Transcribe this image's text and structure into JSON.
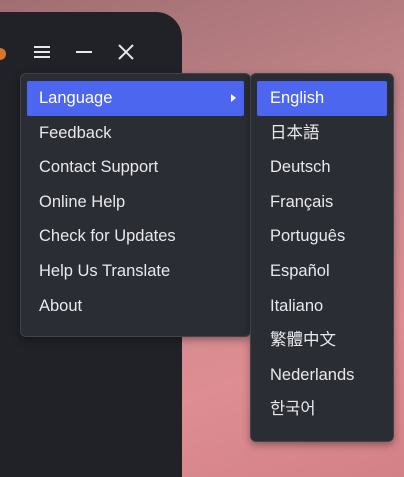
{
  "window": {
    "controls": [
      {
        "name": "menu-icon"
      },
      {
        "name": "minimize-icon"
      },
      {
        "name": "close-icon"
      }
    ]
  },
  "main_menu": {
    "items": [
      {
        "label": "Language",
        "active": true,
        "has_submenu": true
      },
      {
        "label": "Feedback"
      },
      {
        "label": "Contact Support"
      },
      {
        "label": "Online Help"
      },
      {
        "label": "Check for Updates"
      },
      {
        "label": "Help Us Translate"
      },
      {
        "label": "About"
      }
    ]
  },
  "language_menu": {
    "items": [
      {
        "label": "English",
        "active": true
      },
      {
        "label": "日本語"
      },
      {
        "label": "Deutsch"
      },
      {
        "label": "Français"
      },
      {
        "label": "Português"
      },
      {
        "label": "Español"
      },
      {
        "label": "Italiano"
      },
      {
        "label": "繁體中文"
      },
      {
        "label": "Nederlands"
      },
      {
        "label": "한국어"
      }
    ]
  },
  "colors": {
    "accent": "#4d66ef",
    "menu_bg": "#2b2d34",
    "window_bg": "#202228"
  }
}
